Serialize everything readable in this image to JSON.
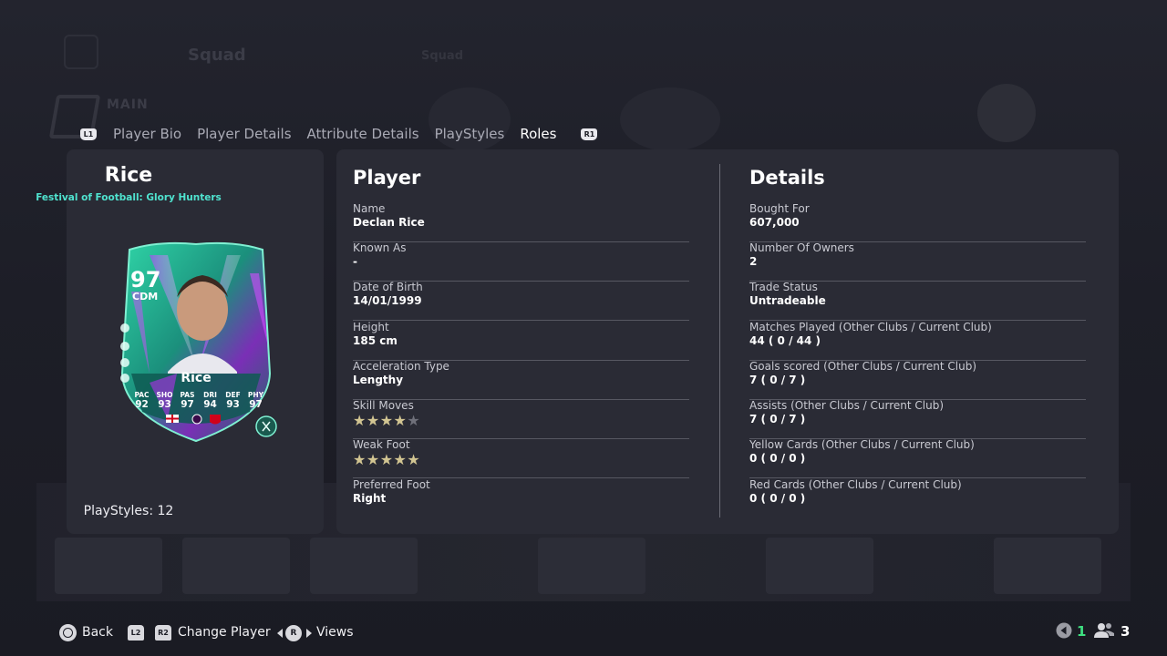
{
  "background": {
    "nav_title": "Squad",
    "nav_subtitle": "Squad",
    "section_label": "MAIN"
  },
  "tabs": {
    "left_shoulder": "L1",
    "right_shoulder": "R1",
    "items": [
      {
        "label": "Player Bio",
        "active": false
      },
      {
        "label": "Player Details",
        "active": false
      },
      {
        "label": "Attribute Details",
        "active": false
      },
      {
        "label": "PlayStyles",
        "active": false
      },
      {
        "label": "Roles",
        "active": true
      }
    ]
  },
  "card_panel": {
    "player_name": "Rice",
    "promo": "Festival of Football: Glory Hunters",
    "playstyles": "PlayStyles: 12",
    "promo_color": "#4fe3cf",
    "card": {
      "rating": "97",
      "position": "CDM",
      "name": "Rice",
      "stats": [
        {
          "label": "PAC",
          "value": "92"
        },
        {
          "label": "SHO",
          "value": "93"
        },
        {
          "label": "PAS",
          "value": "97"
        },
        {
          "label": "DRI",
          "value": "94"
        },
        {
          "label": "DEF",
          "value": "93"
        },
        {
          "label": "PHY",
          "value": "97"
        }
      ]
    }
  },
  "player": {
    "title": "Player",
    "name_label": "Name",
    "name_value": "Declan Rice",
    "known_as_label": "Known As",
    "known_as_value": "-",
    "dob_label": "Date of Birth",
    "dob_value": "14/01/1999",
    "height_label": "Height",
    "height_value": "185 cm",
    "accel_label": "Acceleration Type",
    "accel_value": "Lengthy",
    "skill_label": "Skill Moves",
    "skill_stars": 4,
    "weak_label": "Weak Foot",
    "weak_stars": 5,
    "foot_label": "Preferred Foot",
    "foot_value": "Right",
    "star_color": "#d2c592"
  },
  "details": {
    "title": "Details",
    "bought_label": "Bought For",
    "bought_value": "607,000",
    "owners_label": "Number Of Owners",
    "owners_value": "2",
    "trade_label": "Trade Status",
    "trade_value": "Untradeable",
    "matches_label": "Matches Played (Other Clubs / Current Club)",
    "matches_value": "44 ( 0 / 44 )",
    "goals_label": "Goals scored (Other Clubs / Current Club)",
    "goals_value": "7 ( 0 / 7 )",
    "assists_label": "Assists (Other Clubs / Current Club)",
    "assists_value": "7 ( 0 / 7 )",
    "yellow_label": "Yellow Cards (Other Clubs / Current Club)",
    "yellow_value": "0 ( 0 / 0 )",
    "red_label": "Red Cards (Other Clubs / Current Club)",
    "red_value": "0 ( 0 / 0 )"
  },
  "bottom_bar": {
    "back_label": "Back",
    "l2": "L2",
    "r2": "R2",
    "change_player_label": "Change Player",
    "rstick": "R",
    "views_label": "Views",
    "green_count": "1",
    "user_count": "3",
    "green_color": "#3ee081"
  }
}
